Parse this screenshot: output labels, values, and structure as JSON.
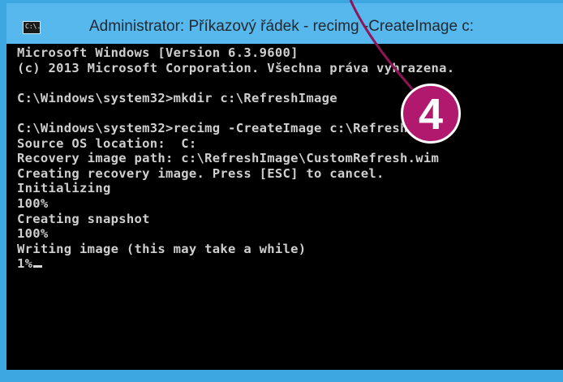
{
  "window": {
    "title": "Administrator: Příkazový řádek - recimg  -CreateImage c:",
    "icon": "cmd-icon",
    "icon_text": "C:\\."
  },
  "console": {
    "lines": [
      "Microsoft Windows [Version 6.3.9600]",
      "(c) 2013 Microsoft Corporation. Všechna práva vyhrazena.",
      "",
      "C:\\Windows\\system32>mkdir c:\\RefreshImage",
      "",
      "C:\\Windows\\system32>recimg -CreateImage c:\\RefreshImage",
      "Source OS location:  C:",
      "Recovery image path: c:\\RefreshImage\\CustomRefresh.wim",
      "Creating recovery image. Press [ESC] to cancel.",
      "Initializing",
      "100%",
      "Creating snapshot",
      "100%",
      "Writing image (this may take a while)"
    ],
    "current_line": "1%"
  },
  "annotation": {
    "badge_number": "4",
    "badge_color": "#b0196d"
  },
  "colors": {
    "frame": "#3da7e1",
    "titlebar": "#57b8ee",
    "console_bg": "#000000",
    "console_text": "#cfcfcf"
  }
}
